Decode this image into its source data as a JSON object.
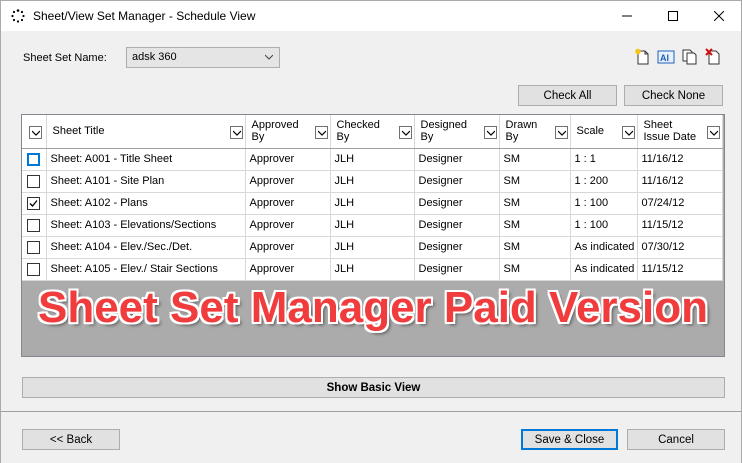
{
  "window": {
    "title": "Sheet/View Set Manager - Schedule View"
  },
  "sheet_set": {
    "label": "Sheet Set Name:",
    "selected": "adsk 360"
  },
  "toolbar": {
    "icons": [
      "new-sheet-icon",
      "text-field-icon",
      "copy-sheet-icon",
      "delete-sheet-icon"
    ]
  },
  "buttons": {
    "check_all": "Check All",
    "check_none": "Check None",
    "show_basic": "Show Basic View",
    "back": "<< Back",
    "save_close": "Save & Close",
    "cancel": "Cancel"
  },
  "table": {
    "columns": [
      {
        "key": "title",
        "label1": "Sheet Title",
        "label2": ""
      },
      {
        "key": "approved",
        "label1": "Approved",
        "label2": "By"
      },
      {
        "key": "checked",
        "label1": "Checked",
        "label2": "By"
      },
      {
        "key": "designed",
        "label1": "Designed",
        "label2": "By"
      },
      {
        "key": "drawn",
        "label1": "Drawn",
        "label2": "By"
      },
      {
        "key": "scale",
        "label1": "Scale",
        "label2": ""
      },
      {
        "key": "issue",
        "label1": "Sheet",
        "label2": "Issue Date"
      }
    ],
    "rows": [
      {
        "checked_state": false,
        "title": "Sheet: A001 - Title Sheet",
        "approved": "Approver",
        "checked": "JLH",
        "designed": "Designer",
        "drawn": "SM",
        "scale": "1 : 1",
        "issue": "11/16/12"
      },
      {
        "checked_state": false,
        "title": "Sheet: A101 - Site Plan",
        "approved": "Approver",
        "checked": "JLH",
        "designed": "Designer",
        "drawn": "SM",
        "scale": "1 : 200",
        "issue": "11/16/12"
      },
      {
        "checked_state": true,
        "title": "Sheet: A102 - Plans",
        "approved": "Approver",
        "checked": "JLH",
        "designed": "Designer",
        "drawn": "SM",
        "scale": "1 : 100",
        "issue": "07/24/12"
      },
      {
        "checked_state": false,
        "title": "Sheet: A103 - Elevations/Sections",
        "approved": "Approver",
        "checked": "JLH",
        "designed": "Designer",
        "drawn": "SM",
        "scale": "1 : 100",
        "issue": "11/15/12"
      },
      {
        "checked_state": false,
        "title": "Sheet: A104 - Elev./Sec./Det.",
        "approved": "Approver",
        "checked": "JLH",
        "designed": "Designer",
        "drawn": "SM",
        "scale": "As indicated",
        "issue": "07/30/12"
      },
      {
        "checked_state": false,
        "title": "Sheet: A105 - Elev./ Stair Sections",
        "approved": "Approver",
        "checked": "JLH",
        "designed": "Designer",
        "drawn": "SM",
        "scale": "As indicated",
        "issue": "11/15/12"
      }
    ]
  },
  "watermark": "Sheet Set Manager Paid Version",
  "colors": {
    "accent": "#0078d7",
    "watermark": "#f03c3c",
    "grid_bg": "#ababab"
  }
}
